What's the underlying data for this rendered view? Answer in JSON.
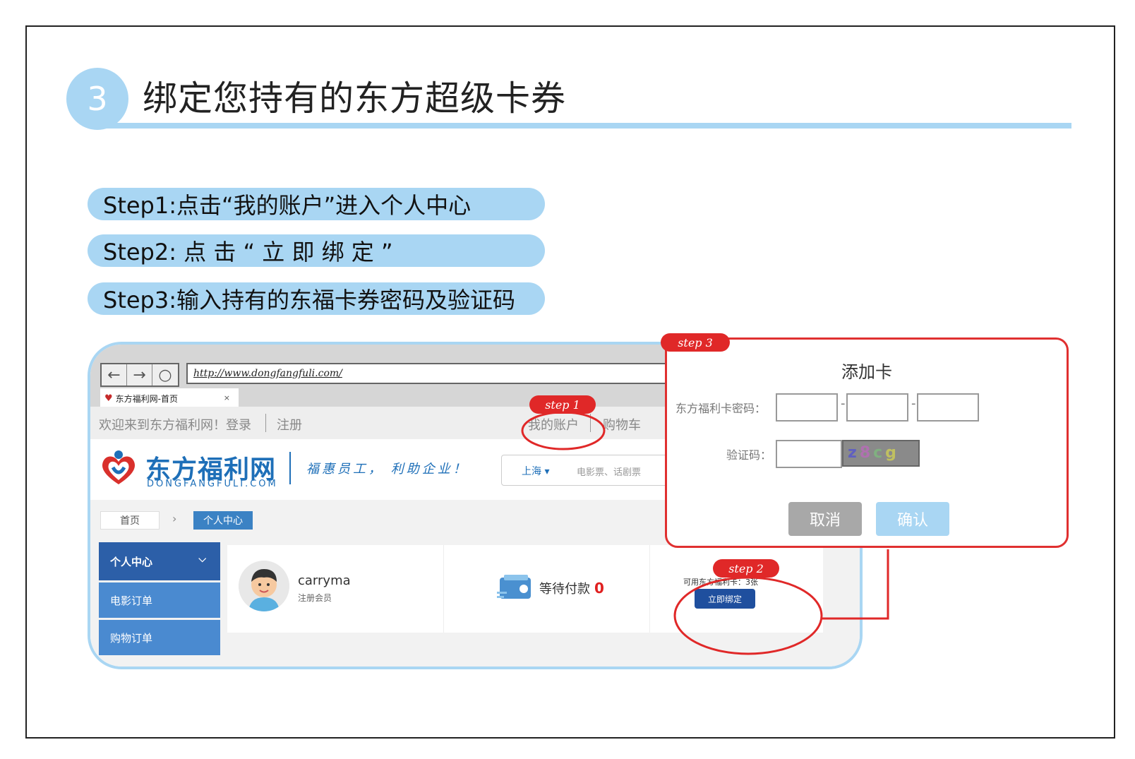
{
  "section": {
    "number": "3",
    "title": "绑定您持有的东方超级卡券"
  },
  "steps": [
    {
      "label": "Step1:点击“我的账户”进入个人中心"
    },
    {
      "label": "Step2: 点 击 “ 立 即 绑 定 ”"
    },
    {
      "label": "Step3:输入持有的东福卡券密码及验证码"
    }
  ],
  "browser": {
    "url": "http://www.dongfangfuli.com/",
    "tab_title": "东方福利网-首页",
    "tab_close": "×",
    "nav_back": "←",
    "nav_forward": "→",
    "nav_refresh": "○"
  },
  "site": {
    "welcome": "欢迎来到东方福利网！登录",
    "register": "注册",
    "my_account": "我的账户",
    "cart": "购物车",
    "brand_name": "东方福利网",
    "brand_sub": "DONGFANGFULI.COM",
    "slogan": "福惠员工，  利助企业！",
    "city": "上海 ▾",
    "search_placeholder": "电影票、话剧票",
    "breadcrumb_home": "首页",
    "breadcrumb_arrow": "›",
    "breadcrumb_current": "个人中心",
    "sidebar": [
      {
        "label": "个人中心",
        "chevron": "⌵"
      },
      {
        "label": "电影订单"
      },
      {
        "label": "购物订单"
      }
    ],
    "username": "carryma",
    "user_role": "注册会员",
    "pending_pay_label": "等待付款",
    "pending_pay_count": "0",
    "cards_available": "可用东方福利卡：3张",
    "bind_now": "立即绑定"
  },
  "modal": {
    "title": "添加卡",
    "password_label": "东方福利卡密码：",
    "dash": "-",
    "code_label": "验证码：",
    "captcha": [
      "z",
      "8",
      "c",
      "g"
    ],
    "cancel": "取消",
    "confirm": "确认"
  },
  "badges": {
    "step1": "step 1",
    "step2": "step 2",
    "step3": "step 3"
  },
  "colors": {
    "accent": "#a9d6f3",
    "highlight_red": "#e02828",
    "brand_blue": "#1e6fb8",
    "sidebar_blue": "#4a8ad0"
  }
}
